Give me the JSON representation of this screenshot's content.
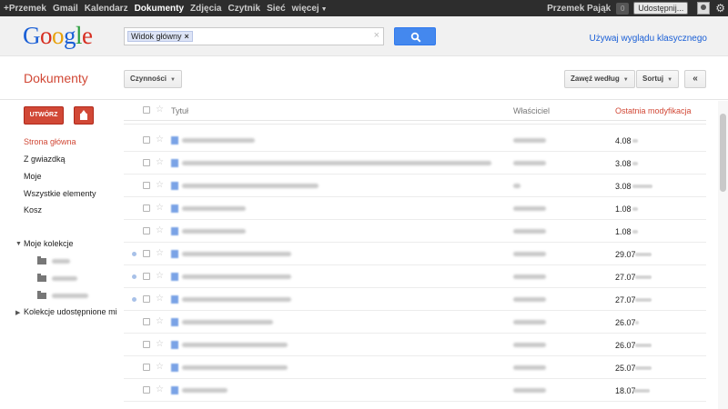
{
  "topbar": {
    "nav": [
      {
        "label": "+Przemek",
        "active": false
      },
      {
        "label": "Gmail",
        "active": false
      },
      {
        "label": "Kalendarz",
        "active": false
      },
      {
        "label": "Dokumenty",
        "active": true
      },
      {
        "label": "Zdjęcia",
        "active": false
      },
      {
        "label": "Czytnik",
        "active": false
      },
      {
        "label": "Sieć",
        "active": false
      },
      {
        "label": "więcej",
        "active": false
      }
    ],
    "username": "Przemek Pająk",
    "notifications": "0",
    "share_label": "Udostępnij..."
  },
  "header": {
    "logo_letters": [
      "G",
      "o",
      "o",
      "g",
      "l",
      "e"
    ],
    "search_chip": "Widok główny",
    "search_clear": "×",
    "classic_link": "Używaj wyglądu klasycznego"
  },
  "toolbar": {
    "app_title": "Dokumenty",
    "actions_label": "Czynności",
    "narrow_label": "Zawęź według",
    "sort_label": "Sortuj",
    "collapse_label": "«"
  },
  "sidebar": {
    "create_label": "UTWÓRZ",
    "nav": [
      {
        "label": "Strona główna",
        "active": true
      },
      {
        "label": "Z gwiazdką",
        "active": false
      },
      {
        "label": "Moje",
        "active": false
      },
      {
        "label": "Wszystkie elementy",
        "active": false
      },
      {
        "label": "Kosz",
        "active": false
      }
    ],
    "my_collections_label": "Moje kolekcje",
    "shared_collections_label": "Kolekcje udostępnione mi"
  },
  "list": {
    "columns": {
      "title": "Tytuł",
      "owner": "Właściciel",
      "modified": "Ostatnia modyfikacja"
    },
    "rows": [
      {
        "date": "4.08",
        "unread": false
      },
      {
        "date": "3.08",
        "unread": false
      },
      {
        "date": "3.08",
        "unread": false
      },
      {
        "date": "1.08",
        "unread": false
      },
      {
        "date": "1.08",
        "unread": false
      },
      {
        "date": "29.07",
        "unread": true
      },
      {
        "date": "27.07",
        "unread": true
      },
      {
        "date": "27.07",
        "unread": true
      },
      {
        "date": "26.07",
        "unread": false
      },
      {
        "date": "26.07",
        "unread": false
      },
      {
        "date": "25.07",
        "unread": false
      },
      {
        "date": "18.07",
        "unread": false
      }
    ]
  },
  "colors": {
    "accent_red": "#d14836",
    "link_blue": "#1a5fd6",
    "search_button": "#4488ee"
  }
}
